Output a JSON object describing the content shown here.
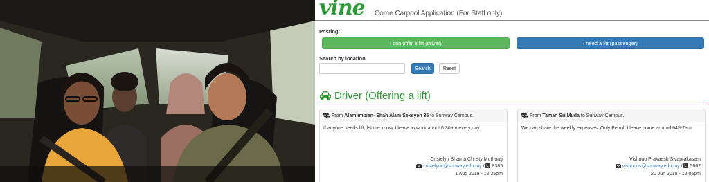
{
  "app": {
    "logo": "vine",
    "title": "Come Carpool Application (For Staff only)"
  },
  "posting": {
    "label": "Posting:",
    "driver_button": "I can offer a lift (driver)",
    "passenger_button": "I need a lift (passenger)"
  },
  "search": {
    "label": "Search by location",
    "placeholder": "",
    "value": "",
    "search_button": "Search",
    "reset_button": "Reset"
  },
  "section": {
    "title": "Driver (Offering a lift)"
  },
  "posts": [
    {
      "from_word": "From",
      "from_location": "Alam impian- Shah Alam Seksyen 35",
      "to_text": "to Sunway Campus.",
      "message": "If anyone needs lift, let me know. I leave to work about 6.30am every day.",
      "name": "Cristelyn Sharna Christy Muthuraj",
      "email": "cristelync@sunway.edu.my",
      "separator": "/",
      "phone": "8385",
      "date": "1 Aug 2019 - 12:35pm"
    },
    {
      "from_word": "From",
      "from_location": "Taman Sri Muda",
      "to_text": "to Sunway Campus.",
      "message": "We can share the weekly expenses. Only Petrol. I leave home around 645-7am.",
      "name": "Vishnuu Prakaesh Sivaprakasam",
      "email": "vishnuus@sunway.edu.my",
      "separator": "/",
      "phone": "5662",
      "date": "20 Jun 2018 - 12:05pm"
    }
  ],
  "colors": {
    "brand_green": "#2e9a37",
    "driver_button": "#5cb85c",
    "passenger_button": "#337ab7",
    "link_blue": "#337ab7"
  },
  "icons": {
    "section": "car-icon",
    "route": "signpost-icon",
    "email": "envelope-icon",
    "phone": "phone-icon"
  }
}
